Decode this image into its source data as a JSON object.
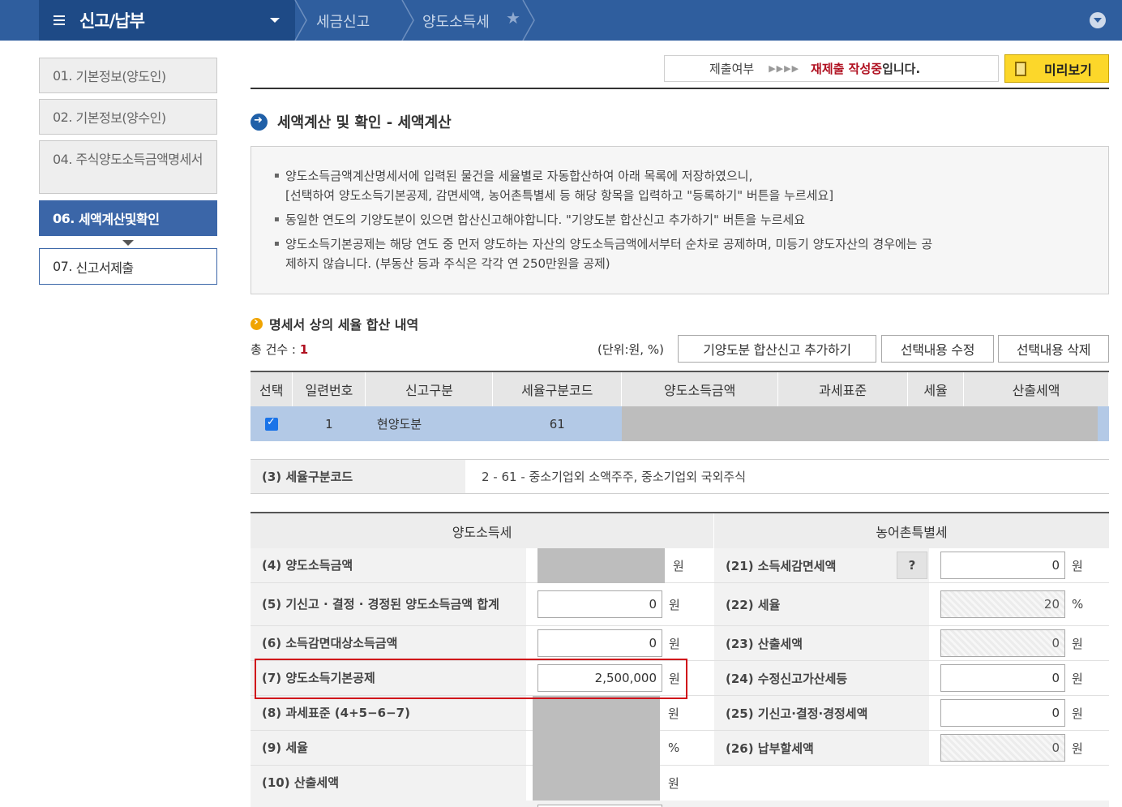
{
  "header": {
    "menu_title": "신고/납부",
    "breadcrumb": [
      "세금신고",
      "양도소득세"
    ]
  },
  "sidebar": {
    "items": [
      {
        "num": "01.",
        "label": "기본정보(양도인)"
      },
      {
        "num": "02.",
        "label": "기본정보(양수인)"
      },
      {
        "num": "04.",
        "label": "주식양도소득금액명세서"
      },
      {
        "num": "06.",
        "label": "세액계산및확인"
      },
      {
        "num": "07.",
        "label": "신고서제출"
      }
    ]
  },
  "status": {
    "label": "제출여부",
    "arrows": "▶▶▶▶",
    "value": "재제출 작성중",
    "suffix": "입니다.",
    "preview_label": "미리보기"
  },
  "section_title": "세액계산 및 확인 - 세액계산",
  "notice": {
    "lines": [
      "양도소득금액계산명세서에 입력된 물건을 세율별로 자동합산하여 아래 목록에 저장하였으니,",
      "[선택하여 양도소득기본공제, 감면세액, 농어촌특별세 등 해당 항목을 입력하고 \"등록하기\" 버튼을 누르세요]",
      "동일한 연도의 기양도분이 있으면 합산신고해야합니다. \"기양도분 합산신고 추가하기\" 버튼을 누르세요",
      "양도소득기본공제는 해당 연도 중 먼저 양도하는 자산의 양도소득금액에서부터 순차로 공제하며, 미등기 양도자산의 경우에는 공",
      "제하지 않습니다. (부동산 등과 주식은 각각 연 250만원을 공제)"
    ]
  },
  "list": {
    "title": "명세서 상의 세율 합산 내역",
    "total_label": "총 건수 : ",
    "total_count": "1",
    "unit": "(단위:원, %)",
    "buttons": [
      "기양도분 합산신고 추가하기",
      "선택내용 수정",
      "선택내용 삭제"
    ],
    "columns": [
      "선택",
      "일련번호",
      "신고구분",
      "세율구분코드",
      "양도소득금액",
      "과세표준",
      "세율",
      "산출세액"
    ],
    "rows": [
      {
        "checked": true,
        "serial": "1",
        "type": "현양도분",
        "code": "61"
      }
    ]
  },
  "rate_code": {
    "label": "(3) 세율구분코드",
    "value": "2 - 61 - 중소기업외 소액주주, 중소기업외 국외주식"
  },
  "detail": {
    "left_header": "양도소득세",
    "right_header": "농어촌특별세",
    "rows": [
      {
        "l_label": "(4) 양도소득금액",
        "l_value": "",
        "l_unit": "원",
        "r_label": "(21) 소득세감면세액",
        "r_value": "0",
        "r_unit": "원",
        "help": "?"
      },
      {
        "l_label": "(5) 기신고 · 결정 · 경정된 양도소득금액 합계",
        "l_value": "0",
        "l_unit": "원",
        "r_label": "(22) 세율",
        "r_value": "20",
        "r_unit": "%"
      },
      {
        "l_label": "(6) 소득감면대상소득금액",
        "l_value": "0",
        "l_unit": "원",
        "r_label": "(23) 산출세액",
        "r_value": "0",
        "r_unit": "원"
      },
      {
        "l_label": "(7) 양도소득기본공제",
        "l_value": "2,500,000",
        "l_unit": "원",
        "r_label": "(24) 수정신고가산세등",
        "r_value": "0",
        "r_unit": "원"
      },
      {
        "l_label": "(8) 과세표준 (4+5−6−7)",
        "l_value": "",
        "l_unit": "원",
        "r_label": "(25) 기신고·결정·경정세액",
        "r_value": "0",
        "r_unit": "원"
      },
      {
        "l_label": "(9) 세율",
        "l_value": "",
        "l_unit": "%",
        "r_label": "(26) 납부할세액",
        "r_value": "0",
        "r_unit": "원"
      },
      {
        "l_label": "(10) 산출세액",
        "l_value": "",
        "l_unit": "원"
      }
    ]
  },
  "colors": {
    "header_bg": "#2f5e9e",
    "active_nav": "#3b66a8",
    "highlight": "#d0101a",
    "accent_yellow": "#fcd72a"
  }
}
